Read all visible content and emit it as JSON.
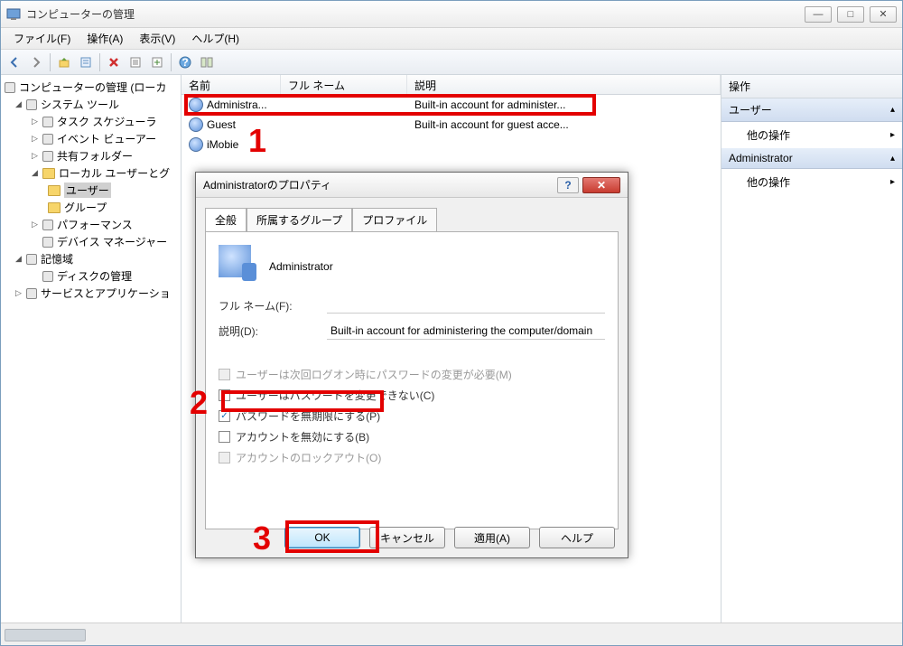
{
  "window": {
    "title": "コンピューターの管理",
    "minimize": "—",
    "maximize": "□",
    "close": "✕"
  },
  "menubar": {
    "file": "ファイル(F)",
    "action": "操作(A)",
    "view": "表示(V)",
    "help": "ヘルプ(H)"
  },
  "tree": {
    "root": "コンピューターの管理 (ローカ",
    "system_tools": "システム ツール",
    "task_scheduler": "タスク スケジューラ",
    "event_viewer": "イベント ビューアー",
    "shared_folders": "共有フォルダー",
    "local_users": "ローカル ユーザーとグ",
    "users": "ユーザー",
    "groups": "グループ",
    "performance": "パフォーマンス",
    "device_mgr": "デバイス マネージャー",
    "storage": "記憶域",
    "disk_mgmt": "ディスクの管理",
    "services_apps": "サービスとアプリケーショ"
  },
  "list": {
    "cols": {
      "name": "名前",
      "fullname": "フル ネーム",
      "desc": "説明"
    },
    "rows": [
      {
        "name": "Administra...",
        "fullname": "",
        "desc": "Built-in account for administer..."
      },
      {
        "name": "Guest",
        "fullname": "",
        "desc": "Built-in account for guest acce..."
      },
      {
        "name": "iMobie",
        "fullname": "",
        "desc": ""
      }
    ]
  },
  "actions": {
    "header": "操作",
    "group1": "ユーザー",
    "item1": "他の操作",
    "group2": "Administrator",
    "item2": "他の操作"
  },
  "dialog": {
    "title": "Administratorのプロパティ",
    "tabs": {
      "general": "全般",
      "member": "所属するグループ",
      "profile": "プロファイル"
    },
    "username": "Administrator",
    "fullname_lbl": "フル ネーム(F):",
    "fullname_val": "",
    "desc_lbl": "説明(D):",
    "desc_val": "Built-in account for administering the computer/domain",
    "chk_mustchange": "ユーザーは次回ログオン時にパスワードの変更が必要(M)",
    "chk_cantchange": "ユーザーはパスワードを変更できない(C)",
    "chk_neverexpire": "パスワードを無期限にする(P)",
    "chk_disabled": "アカウントを無効にする(B)",
    "chk_lockout": "アカウントのロックアウト(O)",
    "btn_ok": "OK",
    "btn_cancel": "キャンセル",
    "btn_apply": "適用(A)",
    "btn_help": "ヘルプ"
  },
  "annotations": {
    "n1": "1",
    "n2": "2",
    "n3": "3"
  }
}
